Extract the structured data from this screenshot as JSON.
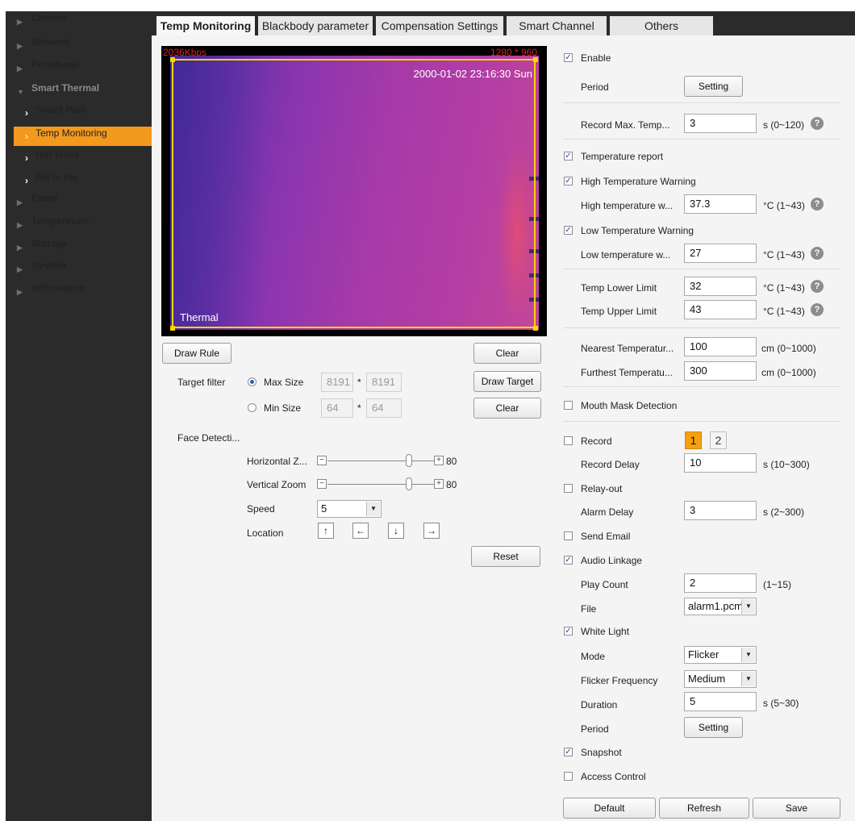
{
  "sidebar": {
    "items": [
      {
        "label": "Camera"
      },
      {
        "label": "Network"
      },
      {
        "label": "Peripheral"
      },
      {
        "label": "Smart Thermal"
      },
      {
        "label": "Event"
      },
      {
        "label": "Temperature"
      },
      {
        "label": "Storage"
      },
      {
        "label": "System"
      },
      {
        "label": "Information"
      }
    ],
    "subitems": [
      {
        "label": "Smart Plan"
      },
      {
        "label": "Temp Monitoring"
      },
      {
        "label": "Hot Trace"
      },
      {
        "label": "Pic In Pic"
      }
    ]
  },
  "tabs": [
    {
      "label": "Temp Monitoring"
    },
    {
      "label": "Blackbody parameter"
    },
    {
      "label": "Compensation Settings"
    },
    {
      "label": "Smart Channel"
    },
    {
      "label": "Others"
    }
  ],
  "video": {
    "bitrate": "2036Kbps",
    "resolution": "1280 * 960",
    "timestamp": "2000-01-02 23:16:30 Sun",
    "channel_name": "Thermal"
  },
  "left": {
    "draw_rule": "Draw Rule",
    "clear": "Clear",
    "draw_target": "Draw Target",
    "clear2": "Clear",
    "target_filter": "Target filter",
    "max_size": "Max Size",
    "max_w": "8191",
    "max_h": "8191",
    "min_size": "Min Size",
    "min_w": "64",
    "min_h": "64",
    "times": "*",
    "face_detection": "Face Detecti...",
    "horizontal_zoom": "Horizontal Z...",
    "horizontal_value": "80",
    "vertical_zoom": "Vertical Zoom",
    "vertical_value": "80",
    "zoom_level": 0.83,
    "speed": "Speed",
    "speed_value": "5",
    "location": "Location",
    "reset": "Reset"
  },
  "right": {
    "enable": "Enable",
    "period": "Period",
    "setting": "Setting",
    "record_max_temp": "Record Max. Temp...",
    "record_max_temp_value": "3",
    "record_max_temp_range": "s (0~120)",
    "temperature_report": "Temperature report",
    "high_temp_warning": "High Temperature Warning",
    "high_temp_w": "High temperature w...",
    "high_temp_value": "37.3",
    "celsius_range": "°C (1~43)",
    "low_temp_warning": "Low Temperature Warning",
    "low_temp_w": "Low temperature w...",
    "low_temp_value": "27",
    "temp_lower_limit": "Temp Lower Limit",
    "temp_lower_value": "32",
    "temp_upper_limit": "Temp Upper Limit",
    "temp_upper_value": "43",
    "nearest_temp": "Nearest Temperatur...",
    "nearest_value": "100",
    "furthest_temp": "Furthest Temperatu...",
    "furthest_value": "300",
    "cm_range": "cm (0~1000)",
    "mouth_mask": "Mouth Mask Detection",
    "record": "Record",
    "channel_1": "1",
    "channel_2": "2",
    "record_delay": "Record Delay",
    "record_delay_value": "10",
    "record_delay_range": "s (10~300)",
    "relay_out": "Relay-out",
    "alarm_delay": "Alarm Delay",
    "alarm_delay_value": "3",
    "alarm_delay_range": "s (2~300)",
    "send_email": "Send Email",
    "audio_linkage": "Audio Linkage",
    "play_count": "Play Count",
    "play_count_value": "2",
    "play_count_range": "(1~15)",
    "file": "File",
    "file_value": "alarm1.pcm",
    "white_light": "White Light",
    "mode": "Mode",
    "mode_value": "Flicker",
    "flicker_frequency": "Flicker Frequency",
    "flicker_value": "Medium",
    "duration": "Duration",
    "duration_value": "5",
    "duration_range": "s (5~30)",
    "period2": "Period",
    "setting2": "Setting",
    "snapshot": "Snapshot",
    "access_control": "Access Control",
    "default": "Default",
    "refresh": "Refresh",
    "save": "Save"
  },
  "colors": {
    "sidebar_bg": "#2b2b2b",
    "active_accent": "#f39a1e",
    "overlay_text": "#e0201a",
    "frame": "#ffd400"
  }
}
